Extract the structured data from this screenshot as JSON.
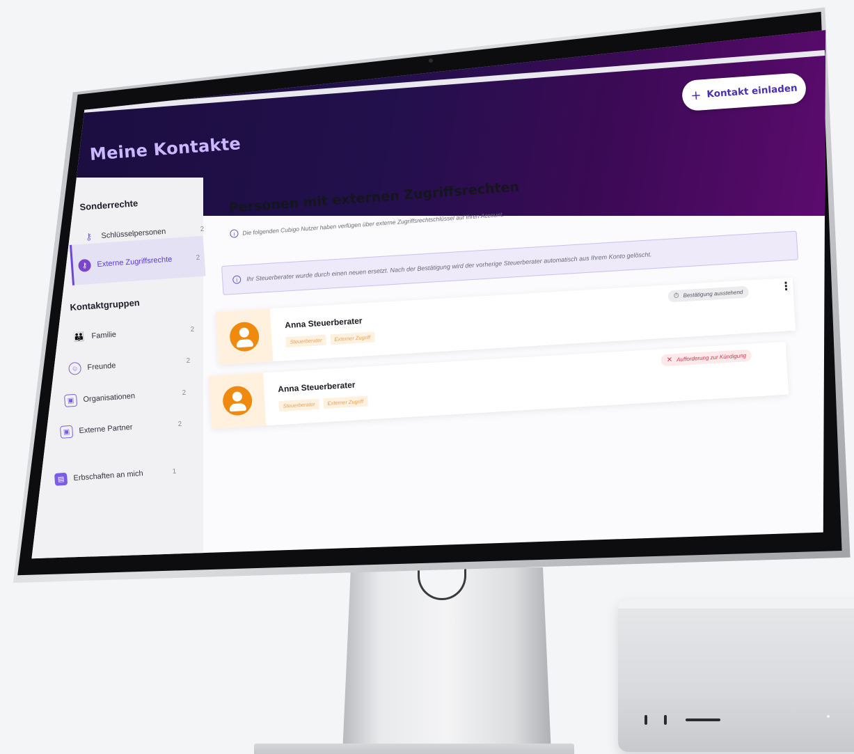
{
  "app": {
    "page_title": "Meine Kontakte",
    "invite_button": "Kontakt einladen"
  },
  "sidebar": {
    "section_special": "Sonderrechte",
    "special_items": [
      {
        "label": "Schlüsselpersonen",
        "count": "2",
        "icon": "key-people-icon"
      },
      {
        "label": "Externe Zugriffsrechte",
        "count": "2",
        "icon": "key-people-icon"
      }
    ],
    "section_groups": "Kontaktgruppen",
    "group_items": [
      {
        "label": "Familie",
        "count": "2",
        "icon": "family-icon"
      },
      {
        "label": "Freunde",
        "count": "2",
        "icon": "smiley-icon"
      },
      {
        "label": "Organisationen",
        "count": "2",
        "icon": "building-icon"
      },
      {
        "label": "Externe Partner",
        "count": "2",
        "icon": "building-icon"
      }
    ],
    "inheritance": {
      "label": "Erbschaften an mich",
      "count": "1",
      "icon": "chest-icon"
    }
  },
  "main": {
    "title": "Personen mit externen Zugriffsrechten",
    "subtitle": "Die folgenden Cubigo Nutzer haben verfügen über externe Zugriffsrechtschlüssel auf Ihren Account.",
    "notice": "Ihr Steuerberater wurde durch einen neuen ersetzt. Nach der Bestätigung wird der vorherige Steuerberater automatisch aus Ihrem Konto gelöscht.",
    "contacts": [
      {
        "name": "Anna Steuerberater",
        "tags": [
          "Steuerberater",
          "Externer Zugriff"
        ],
        "status": "Bestätigung ausstehend",
        "status_icon": "timer-icon"
      },
      {
        "name": "Anna Steuerberater",
        "tags": [
          "Steuerberater",
          "Externer Zugriff"
        ],
        "status": "Aufforderung zur Kündigung",
        "status_icon": "close-icon"
      }
    ]
  },
  "colors": {
    "header_start": "#1a0d3e",
    "header_end": "#5c0b6e",
    "accent": "#6a47d8",
    "avatar": "#ef8a0f",
    "cancel": "#c2404f"
  }
}
